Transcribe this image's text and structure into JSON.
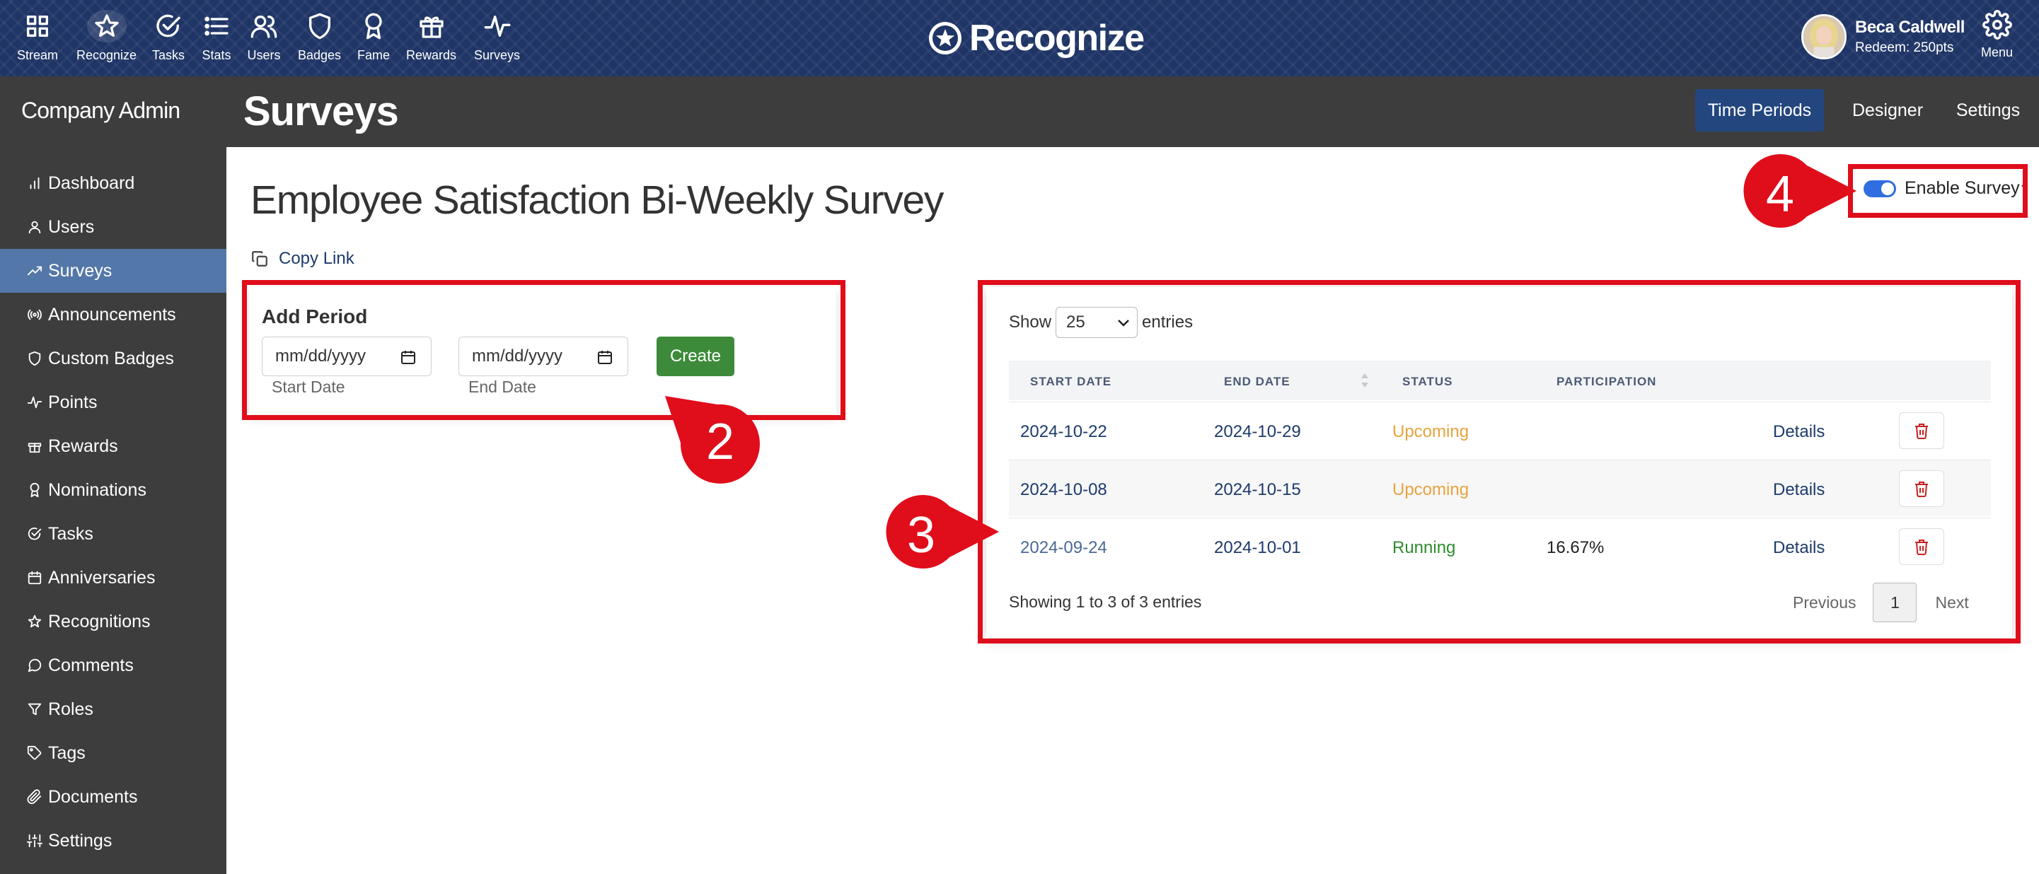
{
  "topnav": {
    "items": [
      {
        "label": "Stream",
        "icon": "grid-icon"
      },
      {
        "label": "Recognize",
        "icon": "star-icon"
      },
      {
        "label": "Tasks",
        "icon": "check-circle-icon"
      },
      {
        "label": "Stats",
        "icon": "list-icon"
      },
      {
        "label": "Users",
        "icon": "users-icon"
      },
      {
        "label": "Badges",
        "icon": "shield-icon"
      },
      {
        "label": "Fame",
        "icon": "award-icon"
      },
      {
        "label": "Rewards",
        "icon": "gift-icon"
      },
      {
        "label": "Surveys",
        "icon": "activity-icon"
      }
    ],
    "brand": "Recognize",
    "user": {
      "name": "Beca Caldwell",
      "points": "Redeem: 250pts"
    },
    "menu_label": "Menu"
  },
  "sidebar": {
    "title": "Company Admin",
    "items": [
      {
        "label": "Dashboard",
        "icon": "bar-chart-icon"
      },
      {
        "label": "Users",
        "icon": "user-icon"
      },
      {
        "label": "Surveys",
        "icon": "trending-icon",
        "active": true
      },
      {
        "label": "Announcements",
        "icon": "broadcast-icon"
      },
      {
        "label": "Custom Badges",
        "icon": "shield-icon"
      },
      {
        "label": "Points",
        "icon": "activity-icon"
      },
      {
        "label": "Rewards",
        "icon": "gift-icon"
      },
      {
        "label": "Nominations",
        "icon": "award-icon"
      },
      {
        "label": "Tasks",
        "icon": "check-circle-icon"
      },
      {
        "label": "Anniversaries",
        "icon": "calendar-icon"
      },
      {
        "label": "Recognitions",
        "icon": "star-icon"
      },
      {
        "label": "Comments",
        "icon": "comment-icon"
      },
      {
        "label": "Roles",
        "icon": "filter-icon"
      },
      {
        "label": "Tags",
        "icon": "tag-icon"
      },
      {
        "label": "Documents",
        "icon": "paperclip-icon"
      },
      {
        "label": "Settings",
        "icon": "sliders-icon"
      }
    ]
  },
  "header": {
    "title": "Surveys",
    "tabs": [
      {
        "label": "Time Periods",
        "active": true
      },
      {
        "label": "Designer"
      },
      {
        "label": "Settings"
      }
    ]
  },
  "survey": {
    "title": "Employee Satisfaction Bi-Weekly Survey",
    "copy_link": "Copy Link",
    "enable_label": "Enable Survey",
    "help_mark": "?",
    "enabled": true
  },
  "add_period": {
    "title": "Add Period",
    "start_placeholder": "mm/dd/yyyy",
    "end_placeholder": "mm/dd/yyyy",
    "start_caption": "Start Date",
    "end_caption": "End Date",
    "create_label": "Create"
  },
  "periods": {
    "show_label": "Show",
    "page_size": "25",
    "entries_label": "entries",
    "columns": [
      "START DATE",
      "END DATE",
      "STATUS",
      "PARTICIPATION"
    ],
    "rows": [
      {
        "start": "2024-10-22",
        "end": "2024-10-29",
        "status": "Upcoming",
        "participation": "",
        "details": "Details"
      },
      {
        "start": "2024-10-08",
        "end": "2024-10-15",
        "status": "Upcoming",
        "participation": "",
        "details": "Details"
      },
      {
        "start": "2024-09-24",
        "end": "2024-10-01",
        "status": "Running",
        "participation": "16.67%",
        "details": "Details"
      }
    ],
    "showing": "Showing 1 to 3 of 3 entries",
    "prev_label": "Previous",
    "current_page": "1",
    "next_label": "Next"
  },
  "callouts": [
    "2",
    "3",
    "4"
  ],
  "colors": {
    "topbar": "#1f3566",
    "sidebar": "#3d3d3d",
    "active_sidebar": "#5377a8",
    "active_tab": "#23467f",
    "create_button": "#3d8b3a",
    "upcoming": "#e8a33c",
    "running": "#2e8b2e",
    "annotation": "#e00d1b"
  }
}
